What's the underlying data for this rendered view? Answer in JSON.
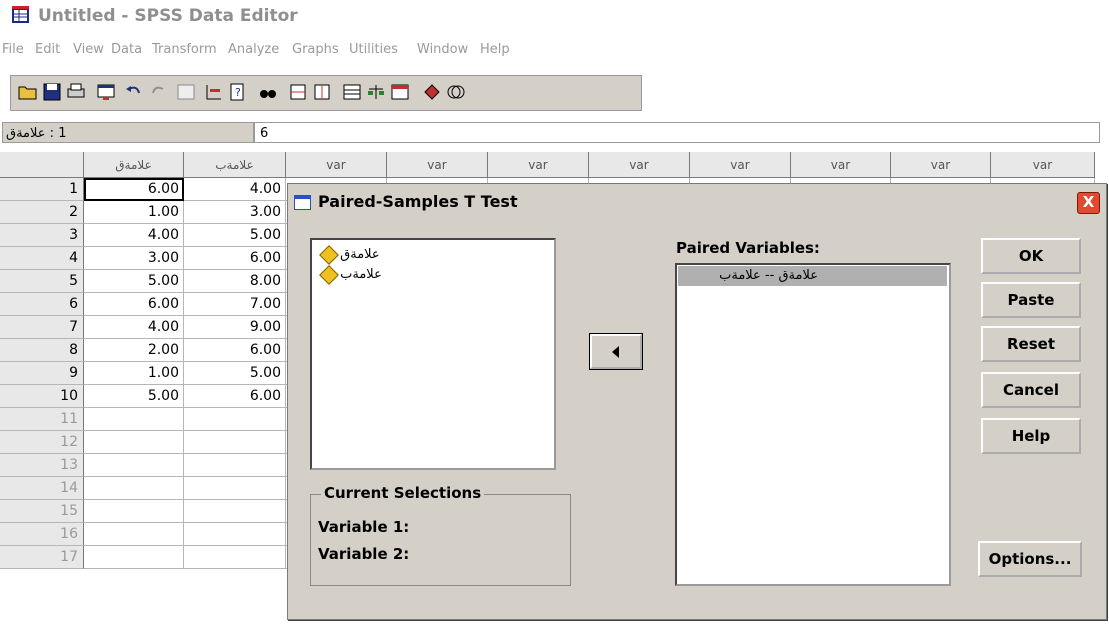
{
  "window": {
    "title": "Untitled - SPSS Data Editor"
  },
  "menu": [
    "File",
    "Edit",
    "View",
    "Data",
    "Transform",
    "Analyze",
    "Graphs",
    "Utilities",
    "Window",
    "Help"
  ],
  "cell_editor": {
    "name": "1 : علامةق",
    "value": "6"
  },
  "grid": {
    "columns": [
      "علامةق",
      "علامةب",
      "var",
      "var",
      "var",
      "var",
      "var",
      "var",
      "var",
      "var"
    ],
    "rows": [
      {
        "n": "1",
        "a": "6.00",
        "b": "4.00"
      },
      {
        "n": "2",
        "a": "1.00",
        "b": "3.00"
      },
      {
        "n": "3",
        "a": "4.00",
        "b": "5.00"
      },
      {
        "n": "4",
        "a": "3.00",
        "b": "6.00"
      },
      {
        "n": "5",
        "a": "5.00",
        "b": "8.00"
      },
      {
        "n": "6",
        "a": "6.00",
        "b": "7.00"
      },
      {
        "n": "7",
        "a": "4.00",
        "b": "9.00"
      },
      {
        "n": "8",
        "a": "2.00",
        "b": "6.00"
      },
      {
        "n": "9",
        "a": "1.00",
        "b": "5.00"
      },
      {
        "n": "10",
        "a": "5.00",
        "b": "6.00"
      },
      {
        "n": "11",
        "a": "",
        "b": ""
      },
      {
        "n": "12",
        "a": "",
        "b": ""
      },
      {
        "n": "13",
        "a": "",
        "b": ""
      },
      {
        "n": "14",
        "a": "",
        "b": ""
      },
      {
        "n": "15",
        "a": "",
        "b": ""
      },
      {
        "n": "16",
        "a": "",
        "b": ""
      },
      {
        "n": "17",
        "a": "",
        "b": ""
      }
    ]
  },
  "dialog": {
    "title": "Paired-Samples T Test",
    "close": "X",
    "source_variables": [
      "علامةق",
      "علامةب"
    ],
    "paired_label": "Paired Variables:",
    "pairs": [
      "علامةق -- علامةب"
    ],
    "current_selections": {
      "legend": "Current Selections",
      "var1": "Variable 1:",
      "var2": "Variable 2:"
    },
    "buttons": {
      "ok": "OK",
      "paste": "Paste",
      "reset": "Reset",
      "cancel": "Cancel",
      "help": "Help",
      "options": "Options..."
    }
  }
}
